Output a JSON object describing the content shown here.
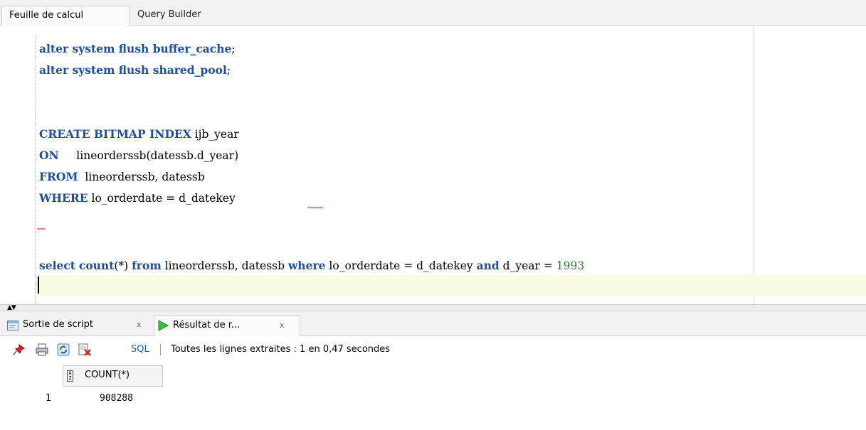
{
  "top_tabs": {
    "worksheet": "Feuille de calcul",
    "query_builder": "Query Builder"
  },
  "editor": {
    "line1": {
      "kw": "alter system flush buffer_cache",
      "rest": ";"
    },
    "line2": {
      "kw": "alter system flush shared_pool",
      "rest": ";"
    },
    "line5": {
      "kw": "CREATE BITMAP INDEX",
      "rest": " ijb_year"
    },
    "line6": {
      "kw": "ON",
      "rest": "     lineorderssb(datessb.d_year)"
    },
    "line7": {
      "kw": "FROM",
      "rest": "  lineorderssb, datessb"
    },
    "line8": {
      "kw": "WHERE",
      "rest": " lo_orderdate = d_datekey"
    },
    "line11": {
      "kw_select": "select",
      "kw_count": "count",
      "t1": "(*) ",
      "kw_from": "from",
      "t2": " lineorderssb, datessb ",
      "kw_where": "where",
      "t3": " lo_orderdate = d_datekey ",
      "kw_and": "and",
      "t4": " d_year = ",
      "num": "1993"
    }
  },
  "bottom_tabs": {
    "script_output": "Sortie de script",
    "script_close": "x",
    "query_result": "Résultat de r...",
    "result_close": "x"
  },
  "toolbar": {
    "sql_label": "SQL",
    "status": "Toutes les lignes extraites : 1 en 0,47 secondes",
    "icons": [
      "pin-icon",
      "print-icon",
      "refresh-icon",
      "delete-icon"
    ]
  },
  "grid": {
    "type_icon_text": "A\nZ",
    "columns": [
      "COUNT(*)"
    ],
    "rows": [
      {
        "num": "1",
        "value": "908288"
      }
    ]
  },
  "colors": {
    "keyword": "#1f4e9e",
    "number": "#2b7a2b",
    "current_line": "#fbfbe3",
    "link": "#1e5fb4"
  }
}
